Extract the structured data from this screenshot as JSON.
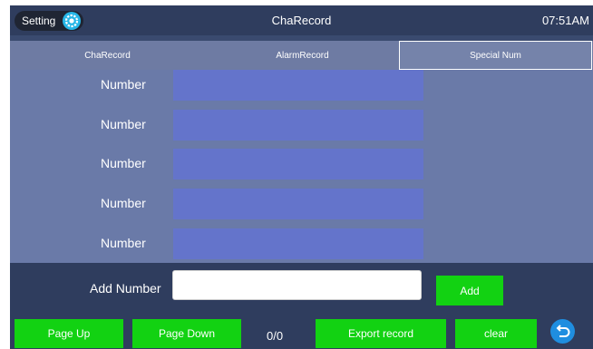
{
  "header": {
    "setting_label": "Setting",
    "title": "ChaRecord",
    "time": "07:51AM"
  },
  "tabs": [
    {
      "label": "ChaRecord",
      "active": false
    },
    {
      "label": "AlarmRecord",
      "active": false
    },
    {
      "label": "Special Num",
      "active": true
    }
  ],
  "numbers": [
    {
      "label": "Number",
      "value": ""
    },
    {
      "label": "Number",
      "value": ""
    },
    {
      "label": "Number",
      "value": ""
    },
    {
      "label": "Number",
      "value": ""
    },
    {
      "label": "Number",
      "value": ""
    }
  ],
  "add": {
    "label": "Add Number",
    "value": "",
    "button": "Add"
  },
  "footer": {
    "page_up": "Page Up",
    "page_down": "Page Down",
    "count": "0/0",
    "export": "Export record",
    "clear": "clear"
  },
  "colors": {
    "accent_green": "#12d212",
    "header_bg": "#2f3d5e",
    "number_box": "#6474cb",
    "back_button": "#1f8ee0"
  },
  "icons": {
    "gear": "gear-icon",
    "back": "back-icon"
  }
}
